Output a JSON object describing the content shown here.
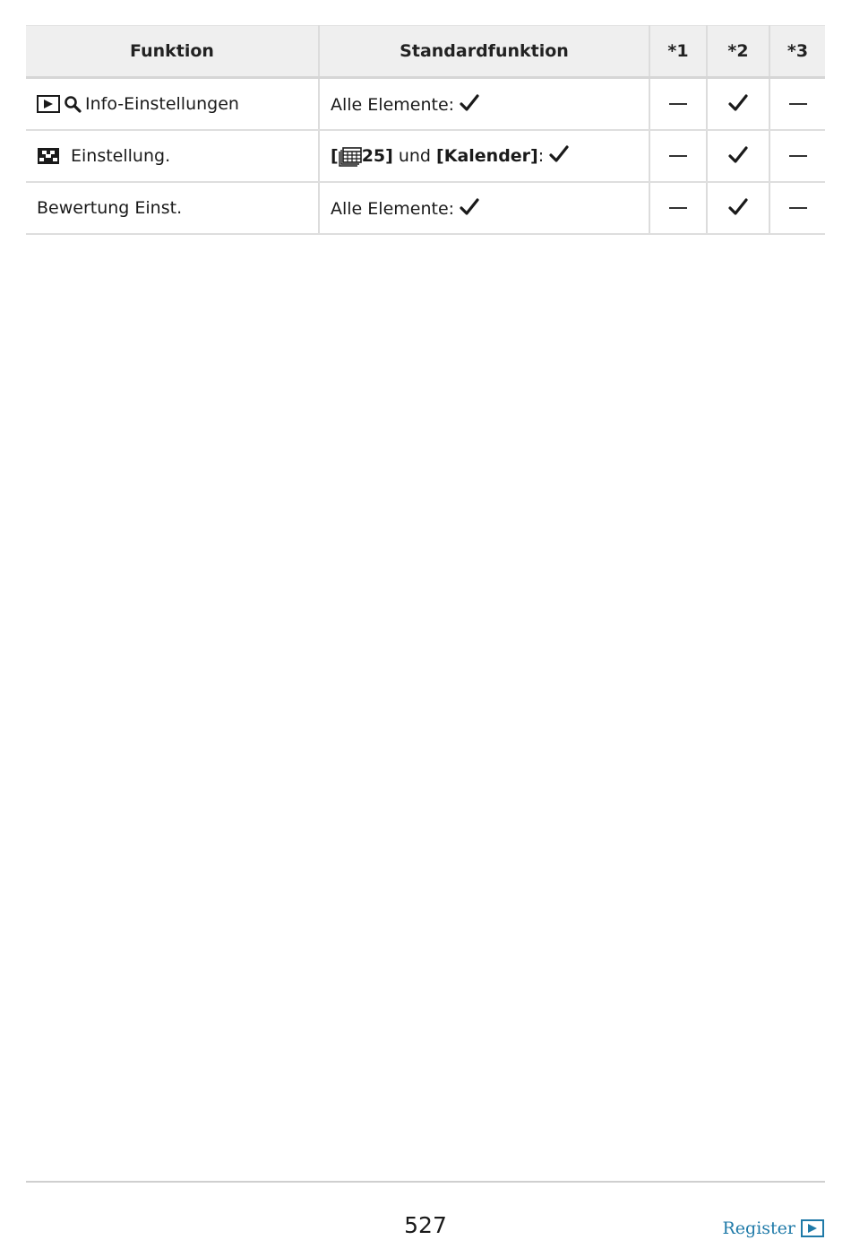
{
  "table": {
    "headers": [
      "Funktion",
      "Standardfunktion",
      "*1",
      "*2",
      "*3"
    ],
    "rows": [
      {
        "function": "Info-Einstellungen",
        "function_icons": [
          "playback-icon",
          "magnify-icon"
        ],
        "standard": {
          "prefix": "Alle Elemente:"
        },
        "marks": [
          "dash",
          "check",
          "dash"
        ]
      },
      {
        "function": "Einstellung.",
        "function_icons": [
          "index-grid-icon"
        ],
        "standard": {
          "open1": "[",
          "value1": "25]",
          "mid": " und ",
          "bold2": "[Kalender]",
          "colon": ":"
        },
        "marks": [
          "dash",
          "check",
          "dash"
        ]
      },
      {
        "function": "Bewertung Einst.",
        "function_icons": [],
        "standard": {
          "prefix": "Alle Elemente:"
        },
        "marks": [
          "dash",
          "check",
          "dash"
        ]
      }
    ]
  },
  "footer": {
    "page_number": "527",
    "register_label": "Register",
    "register_icon": "playback-icon"
  },
  "colors": {
    "header_bg": "#efefef",
    "link": "#1f7aa8"
  }
}
